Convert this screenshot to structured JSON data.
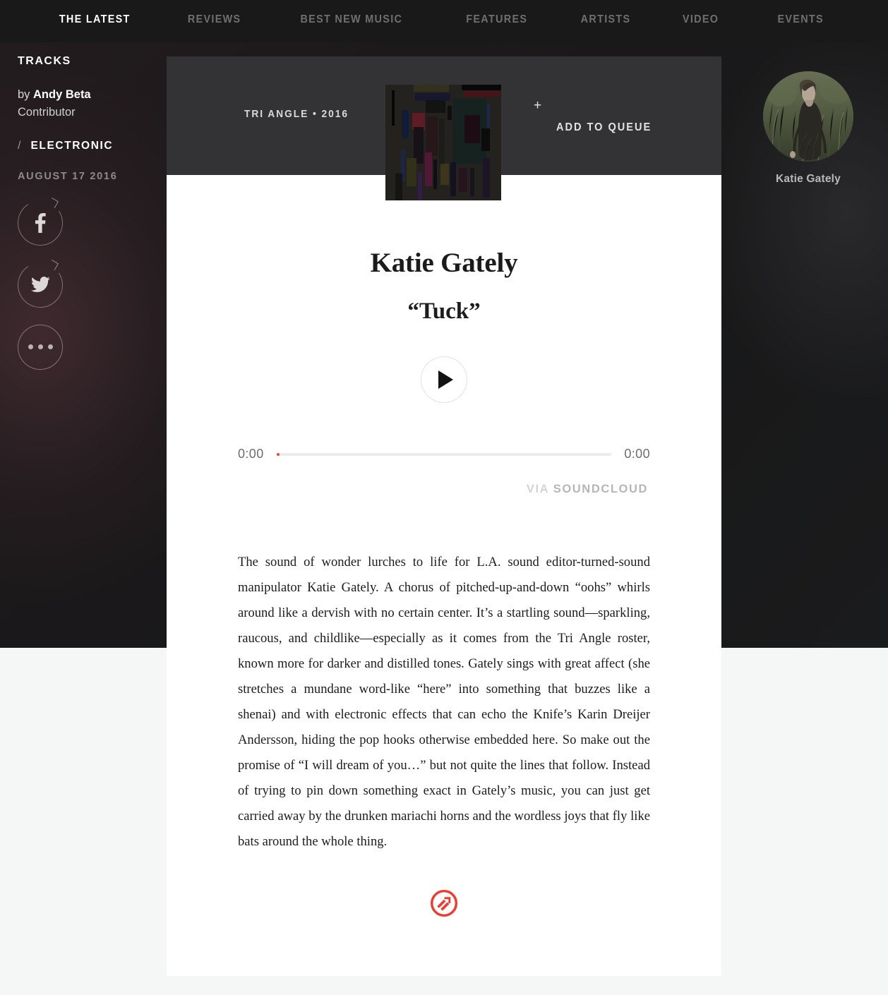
{
  "nav": {
    "items": [
      {
        "label": "THE LATEST",
        "active": true
      },
      {
        "label": "REVIEWS",
        "active": false
      },
      {
        "label": "BEST NEW MUSIC",
        "active": false
      },
      {
        "label": "FEATURES",
        "active": false
      },
      {
        "label": "ARTISTS",
        "active": false
      },
      {
        "label": "VIDEO",
        "active": false
      },
      {
        "label": "EVENTS",
        "active": false
      }
    ]
  },
  "sidebar": {
    "kicker": "TRACKS",
    "by_prefix": "by ",
    "author": "Andy Beta",
    "author_role": "Contributor",
    "genre_separator": "/",
    "genre": "ELECTRONIC",
    "pubdate": "AUGUST 17 2016",
    "social": [
      {
        "name": "facebook-share-icon",
        "glyph": "f"
      },
      {
        "name": "twitter-share-icon",
        "glyph": "twitter"
      },
      {
        "name": "more-share-icon",
        "glyph": "dots"
      }
    ]
  },
  "track_header": {
    "label_year": "TRI ANGLE • 2016",
    "plus": "+",
    "add_to_queue": "ADD TO QUEUE",
    "album_art_alt": "album-artwork"
  },
  "embed": {
    "artist": "Katie Gately",
    "title": "“Tuck”",
    "play_label": "play",
    "elapsed": "0:00",
    "duration": "0:00",
    "via_word": "VIA",
    "via_source": "SOUNDCLOUD",
    "progress_percent": 0
  },
  "article": {
    "body": "The sound of wonder lurches to life for L.A. sound editor-turned-sound manipulator Katie Gately. A chorus of pitched-up-and-down “oohs” whirls around like a dervish with no certain center. It’s a startling sound—sparkling, raucous, and childlike—especially as it comes from the Tri Angle roster, known more for darker and distilled tones. Gately sings with great affect (she stretches a mundane word-like “here” into something that buzzes like a shenai) and with electronic effects that can echo the Knife’s Karin Dreijer Andersson, hiding the pop hooks otherwise embedded here. So make out the promise of “I will dream of you…” but not quite the lines that follow. Instead of trying to pin down something exact in Gately’s music, you can just get carried away by the drunken mariachi horns and the wordless joys that fly like bats around the whole thing."
  },
  "artist_card": {
    "name": "Katie Gately",
    "avatar_alt": "artist-photo"
  },
  "colors": {
    "accent_red": "#e64c3c",
    "nav_background": "#191919",
    "card_background": "#ffffff",
    "header_band": "#333335",
    "page_background": "#f5f6f6"
  }
}
